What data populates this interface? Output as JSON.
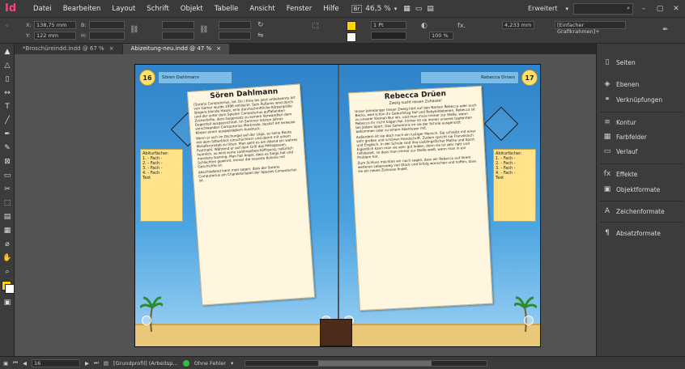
{
  "app": {
    "logo": "Id"
  },
  "menu": [
    "Datei",
    "Bearbeiten",
    "Layout",
    "Schrift",
    "Objekt",
    "Tabelle",
    "Ansicht",
    "Fenster",
    "Hilfe"
  ],
  "menubar": {
    "br_label": "Br",
    "zoom": "46,5 %",
    "workspace": "Erweitert",
    "window_controls": [
      "–",
      "▢",
      "✕"
    ]
  },
  "control": {
    "x_label": "X:",
    "x_value": "138,75 mm",
    "y_label": "Y:",
    "y_value": "122 mm",
    "b_label": "B:",
    "h_label": "H:",
    "stroke_weight": "1 Pt",
    "zoom_pct": "100 %",
    "dim_value": "4,233 mm",
    "frame_style": "[Einfacher Grafikrahmen]+"
  },
  "tabs": [
    {
      "label": "*Broschüreindd.indd @ 67 %",
      "close": "×"
    },
    {
      "label": "Abizeitung-neu.indd @ 47 %",
      "close": "×"
    }
  ],
  "pages": {
    "left_num": "16",
    "right_num": "17",
    "left_header": "Sören Dahlmann",
    "right_header": "Rebecca Drüen",
    "left_sidebox": [
      "Abiturfächer:",
      "1. - Fach -",
      "2. - Fach -",
      "3. - Fach -",
      "4. - Fach -",
      "Text"
    ],
    "right_sidebox": [
      "Abiturfächer:",
      "1. - Fach -",
      "2. - Fach -",
      "3. - Fach -",
      "4. - Fach -",
      "Text"
    ],
    "left_article": {
      "title": "Sören Dahlmann",
      "paragraphs": [
        "(Soreno Computerius, lat. Dir.) Eine bis jetzt unbekannte Art von Gamer wurde 1996 entdeckt. Sein Äußeres wird durch längere blonde Haare, eine durchschnittliche Körpergröße und der unter dem Spielen Computerius auffallenden Zockerbrille, dem Gegensatz zu seinem Verwandten dem Gegenteil ausgezeichnet. Im Sommer letzten Jahres verschwanden Computerius Merkmale, besitzt Art lerweise Körper einen ausgeprägtem Ausdruck.",
        "Wenn er sich im Dschungel auf der Lüge, so seine Beute mit dem Silberblick einschüchtern und damit mit einem Metallkronstab zu töten. Man geht es am Abend ein wahres Festmahl. Während er auf dem Grill das Mittagessen, heimlich, so wird seine Lieblingsbeschäftigung, natürlich meistens Gaming. Man hat Angst, dass es Siege hat und Schlachten gewinnt, immer die neueste Kolonie mit Geschichte ist."
      ],
      "closing": "Abschließend kann man sagen, dass der Soreno Computerius ein Charakterispiel der Spezies Computerius ist."
    },
    "right_article": {
      "title": "Rebecca Drüen",
      "subtitle": "Zweig sucht neuen Zuhause!",
      "paragraphs": [
        "Unser Jahrelanger treuer Zweig hört auf den Namen Rebecca oder auch Becks, weil schon ihr Geburtstag Hof und Babybildebenen. Rebecca ist zu unserer Kleinen Nur wir, und man muss immer zur Stelle, wenn Rebecca ihr nicht folgen fiel. Immer ist sie immer unseres tapfersten bei jedem Sport. Das Geheimnis im sie der Schule ausgenutzt bekommen oder zu einem Abenteuer mit.",
        "Außerdem ist sie doch noch ein lustiger Mensch. Sie schreibt mit einer sehr großen und schönen Handschrift. Zudem spricht sie Französisch und Englisch. In der Schule sind ihre Lieblingsfächer Mathe und Sport. Eigentlich kann man sie sehr gut leiden, denn sie ist sehr nett und hilfsbereit, so dass man immer zur Stelle weiß, wenn man in ein Problem hat.",
        "Zum Schluss möchten wir noch sagen, dass wir Rebecca auf ihrem weiteren Lebensweg viel Glück und Erfolg wünschen und hoffen, dass sie ein neues Zuhause findet."
      ]
    }
  },
  "panel": {
    "groups": [
      [
        "Seiten",
        "Ebenen",
        "Verknüpfungen"
      ],
      [
        "Kontur",
        "Farbfelder",
        "Verlauf"
      ],
      [
        "Effekte",
        "Objektformate"
      ],
      [
        "Zeichenformate"
      ],
      [
        "Absatzformate"
      ]
    ]
  },
  "statusbar": {
    "page": "16",
    "profile": "[Grundprofil] (Arbeitsp...",
    "errors": "Ohne Fehler"
  },
  "colors": {
    "accent": "#ff3d8b",
    "ok": "#2fbf3a"
  },
  "icons": [
    "arrow-icon",
    "direct-select-icon",
    "page-tool-icon",
    "gap-tool-icon",
    "type-icon",
    "line-icon",
    "pen-icon",
    "pencil-icon",
    "rect-frame-icon",
    "rect-icon",
    "scissors-icon",
    "transform-icon",
    "gradient-icon",
    "note-icon",
    "eyedropper-icon",
    "hand-icon",
    "zoom-icon"
  ]
}
